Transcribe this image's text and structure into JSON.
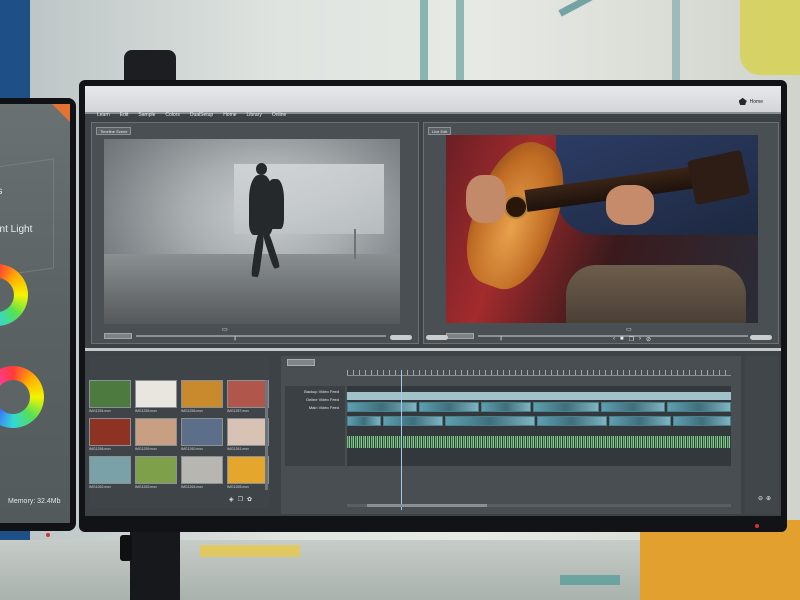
{
  "left_monitor": {
    "label_1": "rs",
    "label_2": "ent Light",
    "memory": "Memory: 32.4Mb"
  },
  "editor": {
    "menu": [
      "Learn",
      "Edit",
      "Sample",
      "Colors",
      "DualSetup",
      "Home",
      "Library",
      "Online"
    ],
    "logo_text": "Home",
    "viewer_left_tab": "Timeline Scene",
    "viewer_right_tab": "Live Edit",
    "track_labels": [
      "Backup Video Feed",
      "Online Video Feed",
      "Main Video Feed"
    ],
    "thumbnails": [
      {
        "name": "IMG1254.mov",
        "color": "#4d7a3e"
      },
      {
        "name": "IMG1255.mov",
        "color": "#e9e5df"
      },
      {
        "name": "IMG1256.mov",
        "color": "#c98a2e"
      },
      {
        "name": "IMG1257.mov",
        "color": "#b0564b"
      },
      {
        "name": "IMG1258.mov",
        "color": "#8e3324"
      },
      {
        "name": "IMG1259.mov",
        "color": "#c89f83"
      },
      {
        "name": "IMG1260.mov",
        "color": "#5c6e8a"
      },
      {
        "name": "IMG1261.mov",
        "color": "#d7c2b3"
      },
      {
        "name": "IMG1262.mov",
        "color": "#7aa1a8"
      },
      {
        "name": "IMG1263.mov",
        "color": "#7ea04a"
      },
      {
        "name": "IMG1264.mov",
        "color": "#b8b6b0"
      },
      {
        "name": "IMG1265.mov",
        "color": "#e4a62c"
      }
    ]
  }
}
